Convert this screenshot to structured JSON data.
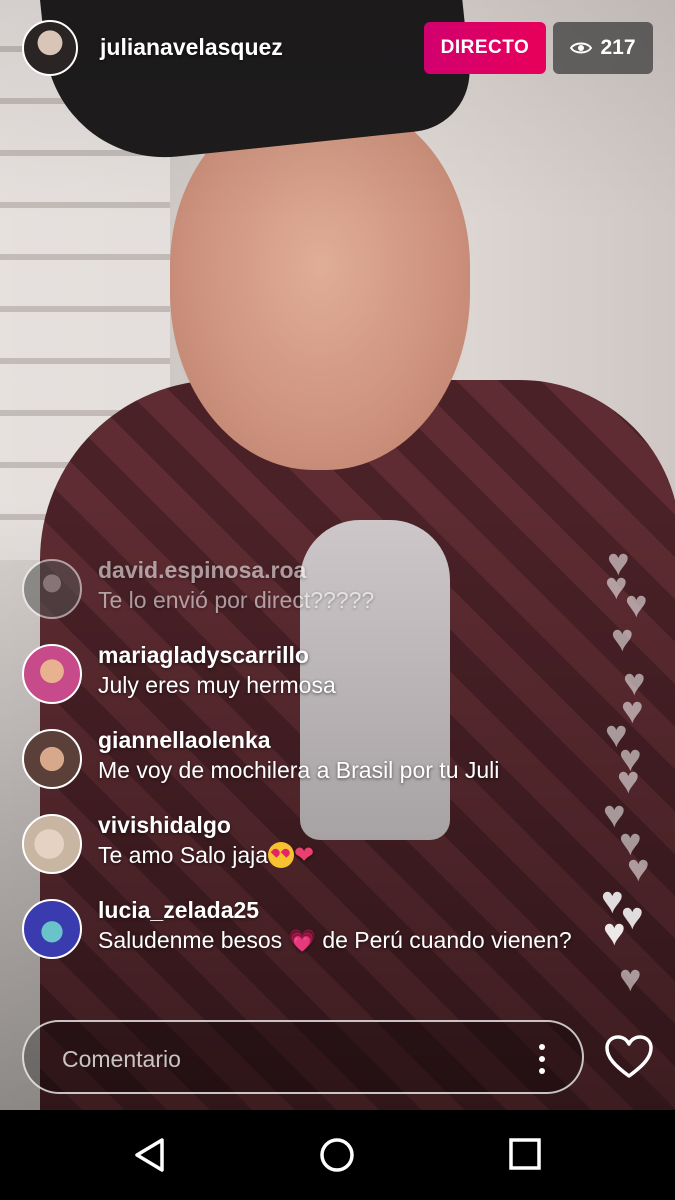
{
  "header": {
    "username": "julianavelasquez",
    "live_label": "DIRECTO",
    "viewer_count": "217",
    "live_color": "#d1006f"
  },
  "comments": [
    {
      "user": "david.espinosa.roa",
      "text": "Te lo envió por direct?????",
      "avatar_color": "#7b7b7b"
    },
    {
      "user": "mariagladyscarrillo",
      "text": "July eres  muy hermosa",
      "avatar_color": "#c74a8a"
    },
    {
      "user": "giannellaolenka",
      "text": "Me voy de mochilera a Brasil por tu Juli",
      "avatar_color": "#8d6b5c"
    },
    {
      "user": "vivishidalgo",
      "text": "Te amo Salo jaja",
      "avatar_color": "#d8c8b8"
    },
    {
      "user": "lucia_zelada25",
      "text_before": "Saludenme besos",
      "text_after": "de Perú cuando vienen?",
      "avatar_color": "#3b3bb0"
    }
  ],
  "input": {
    "placeholder": "Comentario"
  },
  "icons": {
    "viewers": "eye-icon",
    "like": "heart-outline-icon",
    "more": "more-vertical-icon",
    "back": "nav-back-icon",
    "home": "nav-home-icon",
    "recent": "nav-recent-icon"
  }
}
